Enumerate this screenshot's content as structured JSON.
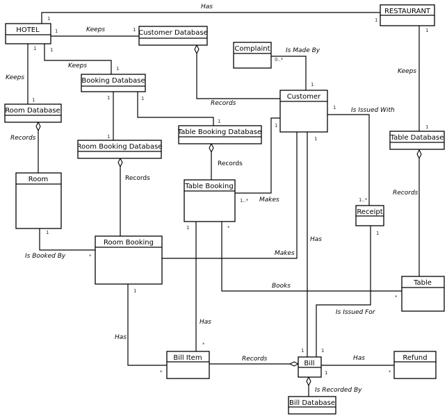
{
  "diagram": {
    "type": "UML class diagram",
    "classes": [
      {
        "id": "hotel",
        "name": "HOTEL"
      },
      {
        "id": "restaurant",
        "name": "RESTAURANT"
      },
      {
        "id": "customer_db",
        "name": "Customer Database"
      },
      {
        "id": "booking_db",
        "name": "Booking Database"
      },
      {
        "id": "complaint",
        "name": "Complaint"
      },
      {
        "id": "customer",
        "name": "Customer"
      },
      {
        "id": "room_db",
        "name": "Room Database"
      },
      {
        "id": "table_booking_db",
        "name": "Table Booking Database"
      },
      {
        "id": "room_booking_db",
        "name": "Room Booking Database"
      },
      {
        "id": "table_db",
        "name": "Table Database"
      },
      {
        "id": "room",
        "name": "Room"
      },
      {
        "id": "table_booking",
        "name": "Table Booking"
      },
      {
        "id": "receipt",
        "name": "Receipt"
      },
      {
        "id": "room_booking",
        "name": "Room Booking"
      },
      {
        "id": "table",
        "name": "Table"
      },
      {
        "id": "bill_item",
        "name": "Bill Item"
      },
      {
        "id": "bill",
        "name": "Bill"
      },
      {
        "id": "refund",
        "name": "Refund"
      },
      {
        "id": "bill_db",
        "name": "Bill Database"
      }
    ],
    "associations": [
      {
        "id": "hotel_restaurant",
        "label": "Has",
        "from": "HOTEL",
        "to": "RESTAURANT",
        "mult_from": "1",
        "mult_to": "1"
      },
      {
        "id": "hotel_customer_db",
        "label": "Keeps",
        "from": "HOTEL",
        "to": "Customer Database",
        "mult_from": "1",
        "mult_to": "1"
      },
      {
        "id": "hotel_booking_db",
        "label": "Keeps",
        "from": "HOTEL",
        "to": "Booking Database",
        "mult_from": "1",
        "mult_to": "1"
      },
      {
        "id": "hotel_room_db",
        "label": "Keeps",
        "from": "HOTEL",
        "to": "Room Database",
        "mult_from": "1",
        "mult_to": "1"
      },
      {
        "id": "restaurant_table_db",
        "label": "Keeps",
        "from": "RESTAURANT",
        "to": "Table Database",
        "mult_from": "1",
        "mult_to": "1"
      },
      {
        "id": "customer_db_customer",
        "label": "Records",
        "from": "Customer Database",
        "to": "Customer",
        "aggregation": true
      },
      {
        "id": "complaint_customer",
        "label": "Is Made By",
        "from": "Complaint",
        "to": "Customer",
        "mult_from": "0..*",
        "mult_to": "1"
      },
      {
        "id": "booking_db_room_booking_db",
        "label": "",
        "from": "Booking Database",
        "to": "Room Booking Database",
        "mult_from": "1",
        "mult_to": "1"
      },
      {
        "id": "booking_db_table_booking_db",
        "label": "",
        "from": "Booking Database",
        "to": "Table Booking Database",
        "mult_from": "1",
        "mult_to": "1"
      },
      {
        "id": "room_db_room",
        "label": "Records",
        "from": "Room Database",
        "to": "Room",
        "aggregation": true
      },
      {
        "id": "room_booking_db_room_booking",
        "label": "Records",
        "from": "Room Booking Database",
        "to": "Room Booking",
        "aggregation": true
      },
      {
        "id": "table_booking_db_table_booking",
        "label": "Records",
        "from": "Table Booking Database",
        "to": "Table Booking",
        "aggregation": true
      },
      {
        "id": "table_db_table",
        "label": "Records",
        "from": "Table Database",
        "to": "Table",
        "aggregation": true
      },
      {
        "id": "customer_table_booking",
        "label": "Makes",
        "from": "Customer",
        "to": "Table Booking",
        "mult_from": "1",
        "mult_to": "1..*"
      },
      {
        "id": "customer_receipt",
        "label": "Is Issued With",
        "from": "Customer",
        "to": "Receipt",
        "mult_from": "1",
        "mult_to": "1..*"
      },
      {
        "id": "customer_room_booking",
        "label": "Makes",
        "from": "Customer",
        "to": "Room Booking"
      },
      {
        "id": "customer_bill",
        "label": "Has",
        "from": "Customer",
        "to": "Bill",
        "mult_from": "1",
        "mult_to": "1"
      },
      {
        "id": "room_room_booking",
        "label": "Is Booked By",
        "from": "Room",
        "to": "Room Booking",
        "mult_from": "1",
        "mult_to": "*"
      },
      {
        "id": "table_booking_table",
        "label": "Books",
        "from": "Table Booking",
        "to": "Table",
        "mult_from": "*",
        "mult_to": "*"
      },
      {
        "id": "table_booking_bill_item",
        "label": "Has",
        "from": "Table Booking",
        "to": "Bill Item",
        "mult_from": "1",
        "mult_to": "*"
      },
      {
        "id": "room_booking_bill_item",
        "label": "Has",
        "from": "Room Booking",
        "to": "Bill Item",
        "mult_from": "1",
        "mult_to": "*"
      },
      {
        "id": "receipt_bill",
        "label": "Is Issued For",
        "from": "Receipt",
        "to": "Bill",
        "mult_from": "1",
        "mult_to": "1"
      },
      {
        "id": "bill_item_bill",
        "label": "Records",
        "from": "Bill Item",
        "to": "Bill",
        "aggregation": true
      },
      {
        "id": "bill_refund",
        "label": "Has",
        "from": "Bill",
        "to": "Refund",
        "mult_from": "1",
        "mult_to": "*"
      },
      {
        "id": "bill_db_bill",
        "label": "Is Recorded By",
        "from": "Bill",
        "to": "Bill Database",
        "aggregation": true
      }
    ],
    "labels": {
      "has": "Has",
      "keeps": "Keeps",
      "records": "Records",
      "is_made_by": "Is Made By",
      "is_issued_with": "Is Issued With",
      "makes": "Makes",
      "is_booked_by": "Is Booked By",
      "books": "Books",
      "is_issued_for": "Is Issued For",
      "is_recorded_by": "Is Recorded By"
    },
    "mult": {
      "one": "1",
      "many": "*",
      "one_many": "1..*",
      "zero_many": "0..*"
    }
  }
}
